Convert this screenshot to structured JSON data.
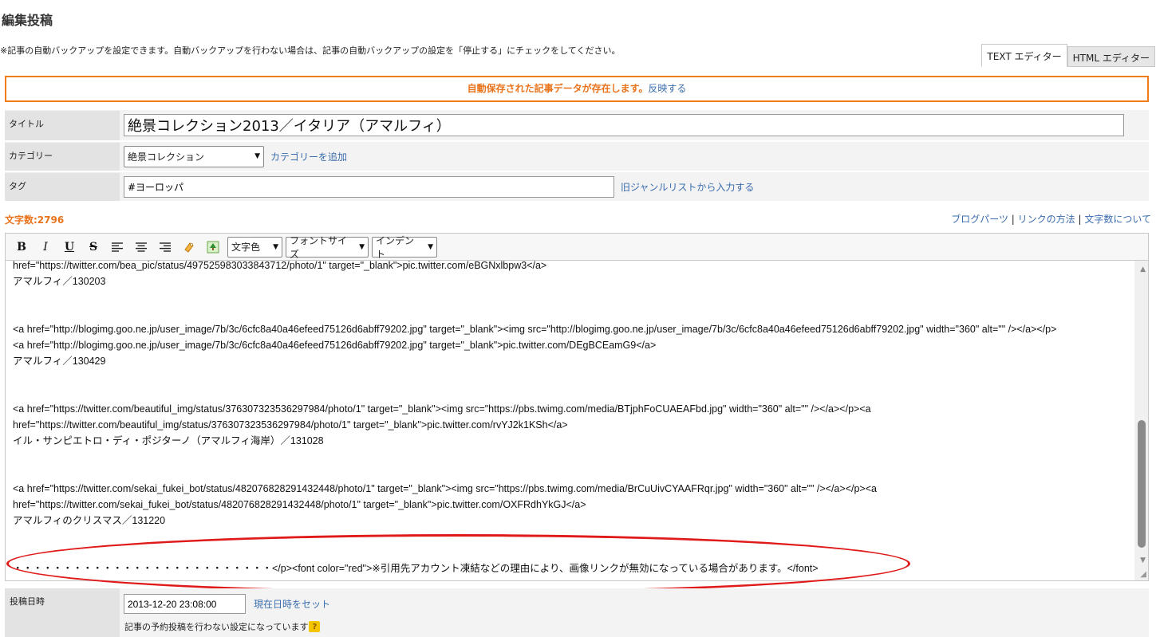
{
  "page": {
    "title": "編集投稿",
    "notice": "※記事の自動バックアップを設定できます。自動バックアップを行わない場合は、記事の自動バックアップの設定を「停止する」にチェックをしてください。"
  },
  "editor_tabs": {
    "text": "TEXT エディター",
    "html": "HTML エディター"
  },
  "autosave": {
    "message": "自動保存された記事データが存在します。",
    "link": "反映する"
  },
  "form": {
    "title_label": "タイトル",
    "title_value": "絶景コレクション2013／イタリア（アマルフィ）",
    "category_label": "カテゴリー",
    "category_value": "絶景コレクション",
    "category_add": "カテゴリーを追加",
    "tag_label": "タグ",
    "tag_value": "#ヨーロッパ",
    "tag_link": "旧ジャンルリストから入力する"
  },
  "char_count": "文字数:2796",
  "help_links": {
    "parts": "ブログパーツ",
    "sep1": " | ",
    "link_method": "リンクの方法",
    "sep2": " | ",
    "about_count": "文字数について"
  },
  "toolbar": {
    "bold": "B",
    "italic": "I",
    "underline": "U",
    "strike": "S",
    "color": "文字色",
    "font_size": "フォントサイズ",
    "indent": "インデント"
  },
  "editor_lines": [
    "href=\"https://twitter.com/bea_pic/status/497525983033843712/photo/1\" target=\"_blank\">pic.twitter.com/eBGNxlbpw3</a>",
    "アマルフィ／130203",
    "",
    "",
    "<a href=\"http://blogimg.goo.ne.jp/user_image/7b/3c/6cfc8a40a46efeed75126d6abff79202.jpg\" target=\"_blank\"><img src=\"http://blogimg.goo.ne.jp/user_image/7b/3c/6cfc8a40a46efeed75126d6abff79202.jpg\" width=\"360\" alt=\"\" /></a></p>",
    "<a href=\"http://blogimg.goo.ne.jp/user_image/7b/3c/6cfc8a40a46efeed75126d6abff79202.jpg\" target=\"_blank\">pic.twitter.com/DEgBCEamG9</a>",
    "アマルフィ／130429",
    "",
    "",
    "<a href=\"https://twitter.com/beautiful_img/status/376307323536297984/photo/1\" target=\"_blank\"><img src=\"https://pbs.twimg.com/media/BTjphFoCUAEAFbd.jpg\" width=\"360\" alt=\"\" /></a></p><a",
    "href=\"https://twitter.com/beautiful_img/status/376307323536297984/photo/1\" target=\"_blank\">pic.twitter.com/rvYJ2k1KSh</a>",
    "イル・サンピエトロ・ディ・ポジターノ（アマルフィ海岸）／131028",
    "",
    "",
    "<a href=\"https://twitter.com/sekai_fukei_bot/status/482076828291432448/photo/1\" target=\"_blank\"><img src=\"https://pbs.twimg.com/media/BrCuUivCYAAFRqr.jpg\" width=\"360\" alt=\"\" /></a></p><a",
    "href=\"https://twitter.com/sekai_fukei_bot/status/482076828291432448/photo/1\" target=\"_blank\">pic.twitter.com/OXFRdhYkGJ</a>",
    "アマルフィのクリスマス／131220",
    "",
    "",
    "・・・・・・・・・・・・・・・・・・・・・・・・・・</p><font color=\"red\">※引用先アカウント凍結などの理由により、画像リンクが無効になっている場合があります。</font>"
  ],
  "date": {
    "label": "投稿日時",
    "value": "2013-12-20 23:08:00",
    "now_link": "現在日時をセット",
    "schedule_note": "記事の予約投稿を行わない設定になっています",
    "help": "?"
  },
  "colors": {
    "accent": "#e8731b",
    "link": "#3a6cad",
    "annotation": "#e01919"
  }
}
